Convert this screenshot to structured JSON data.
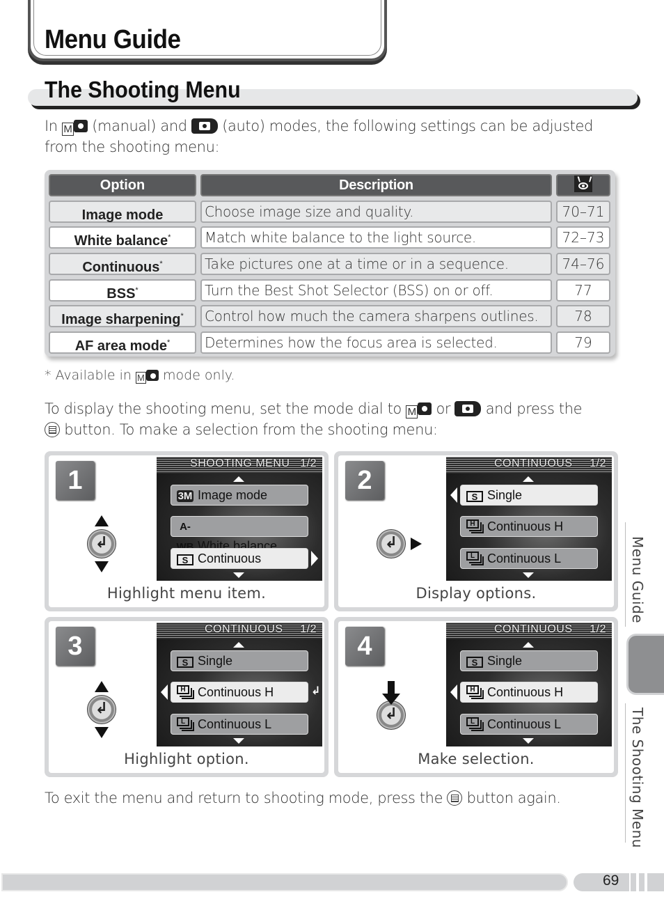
{
  "chapter": {
    "title": "Menu Guide"
  },
  "section": {
    "title": "The Shooting Menu"
  },
  "intro": {
    "prefix": "In",
    "manual_icon": "M",
    "manual_label": "(manual) and",
    "auto_label": "(auto) modes, the following settings can be adjusted",
    "line2": "from the shooting menu:"
  },
  "table": {
    "headers": {
      "option": "Option",
      "description": "Description",
      "page_icon": "eye-reference-icon"
    },
    "rows": [
      {
        "option": "Image mode",
        "asterisk": "",
        "description": "Choose image size and quality.",
        "pages": "70–71"
      },
      {
        "option": "White balance",
        "asterisk": "*",
        "description": "Match white balance to the light source.",
        "pages": "72–73"
      },
      {
        "option": "Continuous",
        "asterisk": "*",
        "description": "Take pictures one at a time or in a sequence.",
        "pages": "74–76"
      },
      {
        "option": "BSS",
        "asterisk": "*",
        "description": "Turn the Best Shot Selector (BSS) on or off.",
        "pages": "77"
      },
      {
        "option": "Image sharpening",
        "asterisk": "*",
        "description": "Control how much the camera sharpens outlines.",
        "pages": "78"
      },
      {
        "option": "AF area mode",
        "asterisk": "*",
        "description": "Determines how the focus area is selected.",
        "pages": "79"
      }
    ]
  },
  "footnote": {
    "prefix": "* Available in",
    "icon": "M",
    "suffix": "mode only."
  },
  "instructions": {
    "line1_a": "To display the shooting menu, set the mode dial to",
    "line1_b": "or",
    "line1_c": "and press the",
    "line2": "button.  To make a selection from the shooting menu:"
  },
  "steps": [
    {
      "number": "1",
      "caption": "Highlight menu item.",
      "screen_title": "SHOOTING MENU   1/2",
      "items": [
        {
          "icon": "3M",
          "label": "Image mode"
        },
        {
          "icon": "A-WB",
          "label": "White balance"
        },
        {
          "icon": "S",
          "label": "Continuous"
        }
      ]
    },
    {
      "number": "2",
      "caption": "Display options.",
      "screen_title": "CONTINUOUS     1/2",
      "items": [
        {
          "icon": "S",
          "label": "Single"
        },
        {
          "icon": "H",
          "label": "Continuous H"
        },
        {
          "icon": "L",
          "label": "Continuous L"
        }
      ]
    },
    {
      "number": "3",
      "caption": "Highlight option.",
      "screen_title": "CONTINUOUS     1/2",
      "items": [
        {
          "icon": "S",
          "label": "Single"
        },
        {
          "icon": "H",
          "label": "Continuous H"
        },
        {
          "icon": "L",
          "label": "Continuous L"
        }
      ]
    },
    {
      "number": "4",
      "caption": "Make selection.",
      "screen_title": "CONTINUOUS     1/2",
      "items": [
        {
          "icon": "S",
          "label": "Single"
        },
        {
          "icon": "H",
          "label": "Continuous H"
        },
        {
          "icon": "L",
          "label": "Continuous L"
        }
      ]
    }
  ],
  "exit": {
    "before": "To exit the menu and return to shooting mode, press the",
    "after": "button again."
  },
  "side_tabs": {
    "chapter": "Menu Guide",
    "section": "The Shooting Menu"
  },
  "footer": {
    "page_number": "69"
  }
}
